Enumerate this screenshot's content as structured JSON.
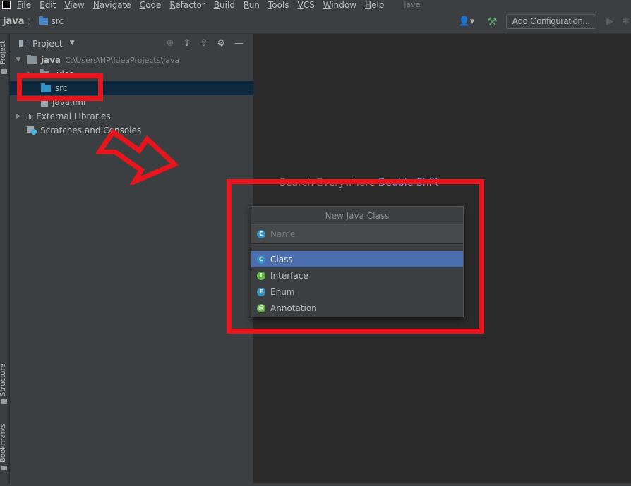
{
  "menubar": {
    "items": [
      "File",
      "Edit",
      "View",
      "Navigate",
      "Code",
      "Refactor",
      "Build",
      "Run",
      "Tools",
      "VCS",
      "Window",
      "Help"
    ],
    "window_title": "java"
  },
  "navbar": {
    "project": "java",
    "crumb": "src",
    "add_config_label": "Add Configuration...",
    "icons": [
      "user-icon",
      "hammer-icon",
      "run-icon",
      "debug-icon"
    ]
  },
  "left_strip": {
    "tabs": [
      "Project",
      "Structure",
      "Bookmarks"
    ]
  },
  "project_panel": {
    "title": "Project",
    "tree": [
      {
        "label": "java",
        "path": "C:\\Users\\HP\\IdeaProjects\\java",
        "expanded": true
      },
      {
        "label": ".idea"
      },
      {
        "label": "src",
        "selected": true
      },
      {
        "label": "java.iml"
      },
      {
        "label": "External Libraries"
      },
      {
        "label": "Scratches and Consoles"
      }
    ]
  },
  "editor": {
    "hint_text": "Search Everywhere",
    "hint_shortcut": "Double Shift"
  },
  "new_class_dialog": {
    "title": "New Java Class",
    "name_placeholder": "Name",
    "kinds": [
      {
        "label": "Class",
        "badge": "C",
        "selected": true
      },
      {
        "label": "Interface",
        "badge": "I"
      },
      {
        "label": "Enum",
        "badge": "E"
      },
      {
        "label": "Annotation",
        "badge": "@"
      }
    ]
  },
  "colors": {
    "background": "#2b2b2b",
    "panel": "#3c3f41",
    "selection": "#4b6eaf",
    "annotation_red": "#e8161c"
  }
}
